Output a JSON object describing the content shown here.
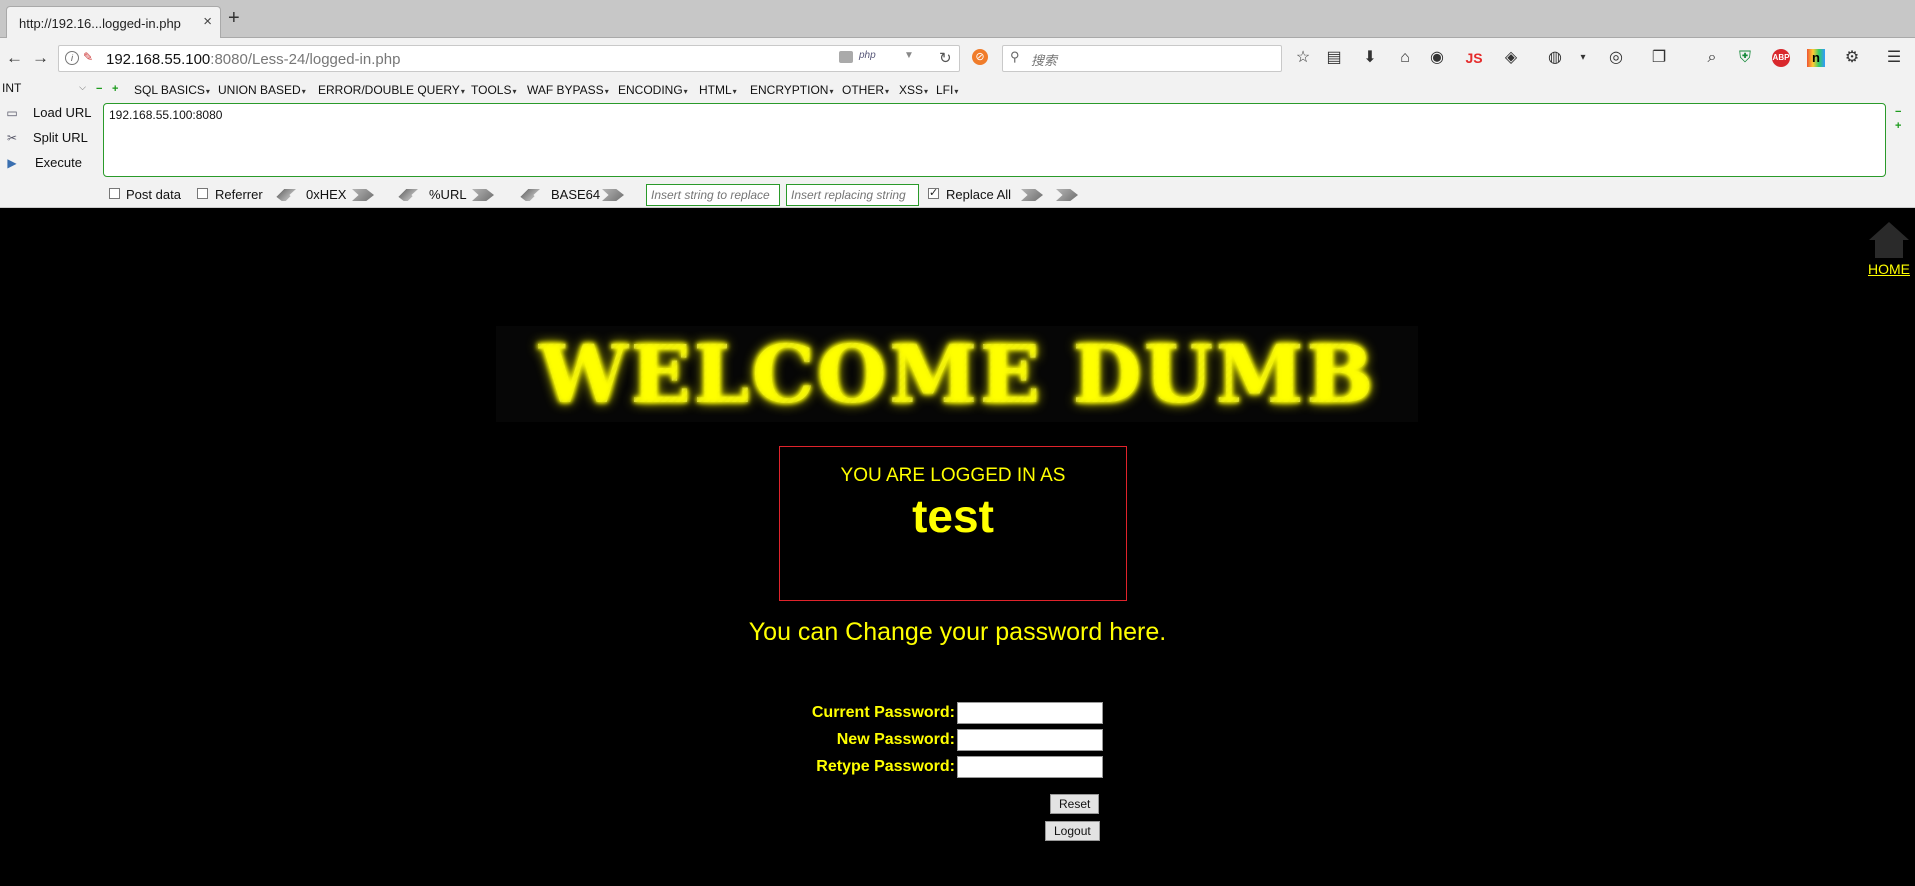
{
  "browser": {
    "tab": {
      "title": "http://192.16...logged-in.php",
      "close_icon": "×"
    },
    "new_tab_icon": "+",
    "nav": {
      "back_icon": "←",
      "forward_icon": "→",
      "url_host": "192.168.55.100",
      "url_rest": ":8080/Less-24/logged-in.php",
      "php_badge": "php",
      "reload_icon": "↻",
      "search_placeholder": "搜索",
      "js_label": "JS",
      "abp_label": "ABP"
    }
  },
  "hackbar": {
    "encoding_select": "INT",
    "menu": [
      "SQL BASICS",
      "UNION BASED",
      "ERROR/DOUBLE QUERY",
      "TOOLS",
      "WAF BYPASS",
      "ENCODING",
      "HTML",
      "ENCRYPTION",
      "OTHER",
      "XSS",
      "LFI"
    ],
    "actions": {
      "load": "Load URL",
      "split": "Split URL",
      "execute": "Execute"
    },
    "url_value": "192.168.55.100:8080",
    "options": {
      "post_data": "Post data",
      "referrer": "Referrer",
      "hex": "0xHEX",
      "url": "%URL",
      "base64": "BASE64",
      "replace_placeholder": "Insert string to replace",
      "replacing_placeholder": "Insert replacing string",
      "replace_all": "Replace All"
    }
  },
  "page": {
    "home_label": "HOME",
    "banner": "WELCOME DUMB",
    "logged_in_label": "YOU ARE LOGGED IN AS",
    "username": "test",
    "change_text": "You can Change your password here.",
    "form": {
      "current": "Current Password:",
      "new": "New Password:",
      "retype": "Retype Password:",
      "reset": "Reset",
      "logout": "Logout"
    }
  }
}
